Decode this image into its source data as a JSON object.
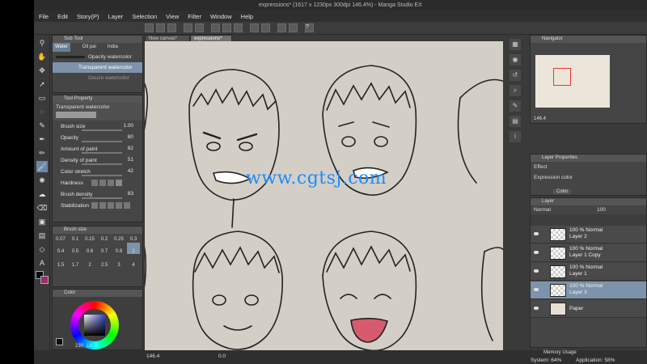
{
  "window": {
    "title": "expressions* (1617 x 1230px 300dpi 146.4%) - Manga Studio EX"
  },
  "menu": [
    "File",
    "Edit",
    "Story(P)",
    "Layer",
    "Selection",
    "View",
    "Filter",
    "Window",
    "Help"
  ],
  "tabs": {
    "doc1": "New canvas*",
    "doc2": "expressions*"
  },
  "subtool": {
    "header": "Sub Tool",
    "tabs": [
      "Water",
      "Oil pai",
      "India"
    ],
    "items": [
      "Opacity watercolor",
      "Transparent watercolor",
      "Gauze watercolor"
    ]
  },
  "toolprop": {
    "header": "Tool Property",
    "name": "Transparent watercolor",
    "rows": [
      {
        "label": "Brush size",
        "value": "1.00"
      },
      {
        "label": "Opacity",
        "value": "80"
      },
      {
        "label": "Amount of paint",
        "value": "82"
      },
      {
        "label": "Density of paint",
        "value": "51"
      },
      {
        "label": "Color stretch",
        "value": "42"
      },
      {
        "label": "Hardness",
        "value": ""
      },
      {
        "label": "Brush density",
        "value": "83"
      },
      {
        "label": "Stabilization",
        "value": ""
      }
    ]
  },
  "brushsize": {
    "header": "Brush size",
    "row1": [
      "0.07",
      "0.1",
      "0.15",
      "0.2",
      "0.25",
      "0.3"
    ],
    "row2": [
      "0.4",
      "0.5",
      "0.6",
      "0.7",
      "0.8",
      "1"
    ],
    "row3": [
      "1.5",
      "1.7",
      "2",
      "2.5",
      "3",
      "4"
    ]
  },
  "color": {
    "header": "Color",
    "h": "230",
    "s": "14",
    "v": "0"
  },
  "navigator": {
    "header": "Navigator",
    "zoom": "146.4"
  },
  "layerprop": {
    "header": "Layer Properties",
    "effect": "Effect",
    "expression": "Expression color",
    "expr_value": "Color"
  },
  "layers": {
    "header": "Layer",
    "blend": "Normal",
    "opacity": "100",
    "items": [
      {
        "pct": "100 %",
        "mode": "Normal",
        "name": "Layer 2"
      },
      {
        "pct": "100 %",
        "mode": "Normal",
        "name": "Layer 1 Copy"
      },
      {
        "pct": "100 %",
        "mode": "Normal",
        "name": "Layer 1"
      },
      {
        "pct": "100 %",
        "mode": "Normal",
        "name": "Layer 3"
      },
      {
        "pct": "",
        "mode": "",
        "name": "Paper"
      }
    ]
  },
  "status": {
    "zoom": "146.4",
    "angle": "0.0",
    "memory_header": "Memory Usage",
    "system": "System: 64%",
    "application": "Application: 58%"
  },
  "watermark": "www.cgtsj.com"
}
